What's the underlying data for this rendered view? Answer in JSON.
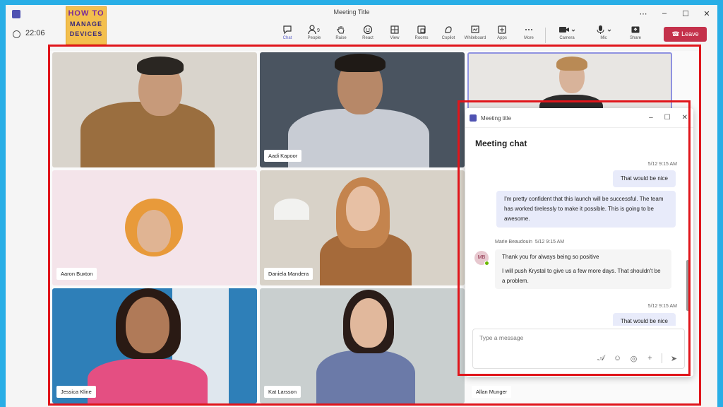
{
  "window": {
    "title": "Meeting Title",
    "timer": "22:06",
    "controls": [
      "⋯",
      "–",
      "☐",
      "✕"
    ]
  },
  "brand": {
    "line1": "HOW TO",
    "line2": "MANAGE",
    "line3": "DEVICES"
  },
  "toolbar": {
    "items": [
      {
        "label": "Chat",
        "icon": "chat-icon"
      },
      {
        "label": "People",
        "icon": "people-icon"
      },
      {
        "label": "Raise",
        "icon": "hand-icon"
      },
      {
        "label": "React",
        "icon": "smile-icon"
      },
      {
        "label": "View",
        "icon": "grid-icon"
      },
      {
        "label": "Rooms",
        "icon": "rooms-icon"
      },
      {
        "label": "Copilot",
        "icon": "copilot-icon"
      },
      {
        "label": "Whiteboard",
        "icon": "whiteboard-icon"
      },
      {
        "label": "Apps",
        "icon": "plus-square-icon"
      },
      {
        "label": "More",
        "icon": "more-icon"
      }
    ],
    "camera_label": "Camera",
    "mic_label": "Mic",
    "share_label": "Share",
    "leave_label": "Leave",
    "people_count": "9"
  },
  "participants": [
    "Aadi Kapoor",
    "Aaron Buxton",
    "Daniela Mandera",
    "Jessica Kline",
    "Kat Larsson",
    "Allan Munger"
  ],
  "chat": {
    "window_title": "Meeting title",
    "title": "Meeting chat",
    "messages": {
      "ts1": "5/12 9:15 AM",
      "m1": "That would be nice",
      "m2": "I'm pretty confident that this launch will be successful. The team has worked tirelessly to make it possible. This is going to be awesome.",
      "sender": "Marie Beaudouin",
      "sender_ts": "5/12 9:15 AM",
      "avatar": "MB",
      "m3": "Thank you for always being so positive",
      "m4": "I will push Krystal to give us a few more days. That shouldn't be a problem.",
      "ts2": "5/12 9:15 AM",
      "m5": "That would be nice"
    },
    "compose_placeholder": "Type a message"
  },
  "colors": {
    "accent": "#5b5fc7",
    "leave": "#c4314b",
    "annotation": "#e0151b",
    "outer": "#29aee6"
  }
}
